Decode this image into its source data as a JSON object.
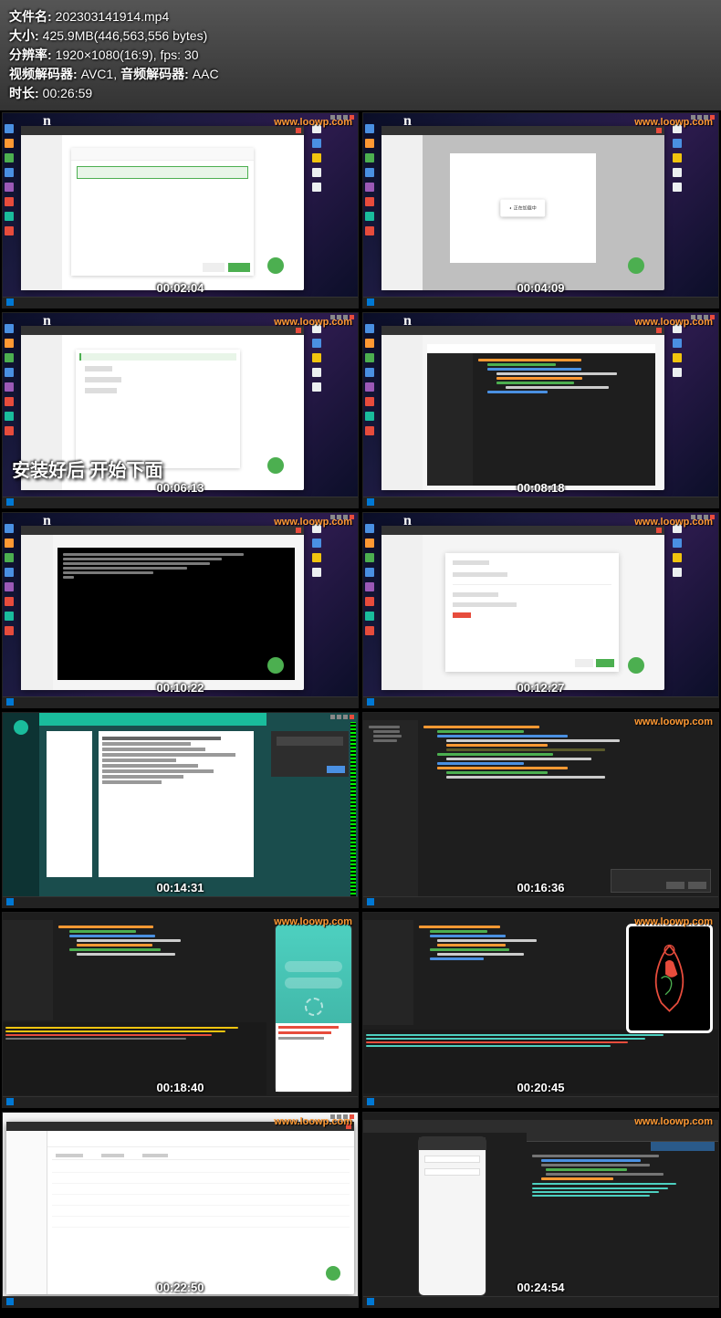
{
  "metadata": {
    "filename_label": "文件名:",
    "filename_value": "202303141914.mp4",
    "size_label": "大小:",
    "size_value": "425.9MB(446,563,556 bytes)",
    "resolution_label": "分辨率:",
    "resolution_value": "1920×1080(16:9), fps: 30",
    "video_codec_label": "视频解码器:",
    "video_codec_value": "AVC1,",
    "audio_codec_label": "音频解码器:",
    "audio_codec_value": "AAC",
    "duration_label": "时长:",
    "duration_value": "00:26:59"
  },
  "watermark": "www.loowp.com",
  "thumbnails": [
    {
      "timestamp": "00:02:04",
      "subtitle": "",
      "type": "browser-light-dialog"
    },
    {
      "timestamp": "00:04:09",
      "subtitle": "",
      "type": "browser-loading"
    },
    {
      "timestamp": "00:06:13",
      "subtitle": "安装好后 开始下面",
      "type": "browser-popup"
    },
    {
      "timestamp": "00:08:18",
      "subtitle": "",
      "type": "ide-dark"
    },
    {
      "timestamp": "00:10:22",
      "subtitle": "",
      "type": "terminal"
    },
    {
      "timestamp": "00:12:27",
      "subtitle": "",
      "type": "browser-form"
    },
    {
      "timestamp": "00:14:31",
      "subtitle": "",
      "type": "teal-admin"
    },
    {
      "timestamp": "00:16:36",
      "subtitle": "",
      "type": "ide-full"
    },
    {
      "timestamp": "00:18:40",
      "subtitle": "",
      "type": "ide-phone-teal"
    },
    {
      "timestamp": "00:20:45",
      "subtitle": "",
      "type": "ide-phone-red"
    },
    {
      "timestamp": "00:22:50",
      "subtitle": "",
      "type": "file-manager"
    },
    {
      "timestamp": "00:24:54",
      "subtitle": "",
      "type": "devtools-phone"
    }
  ],
  "loading_text": "正在加载中"
}
